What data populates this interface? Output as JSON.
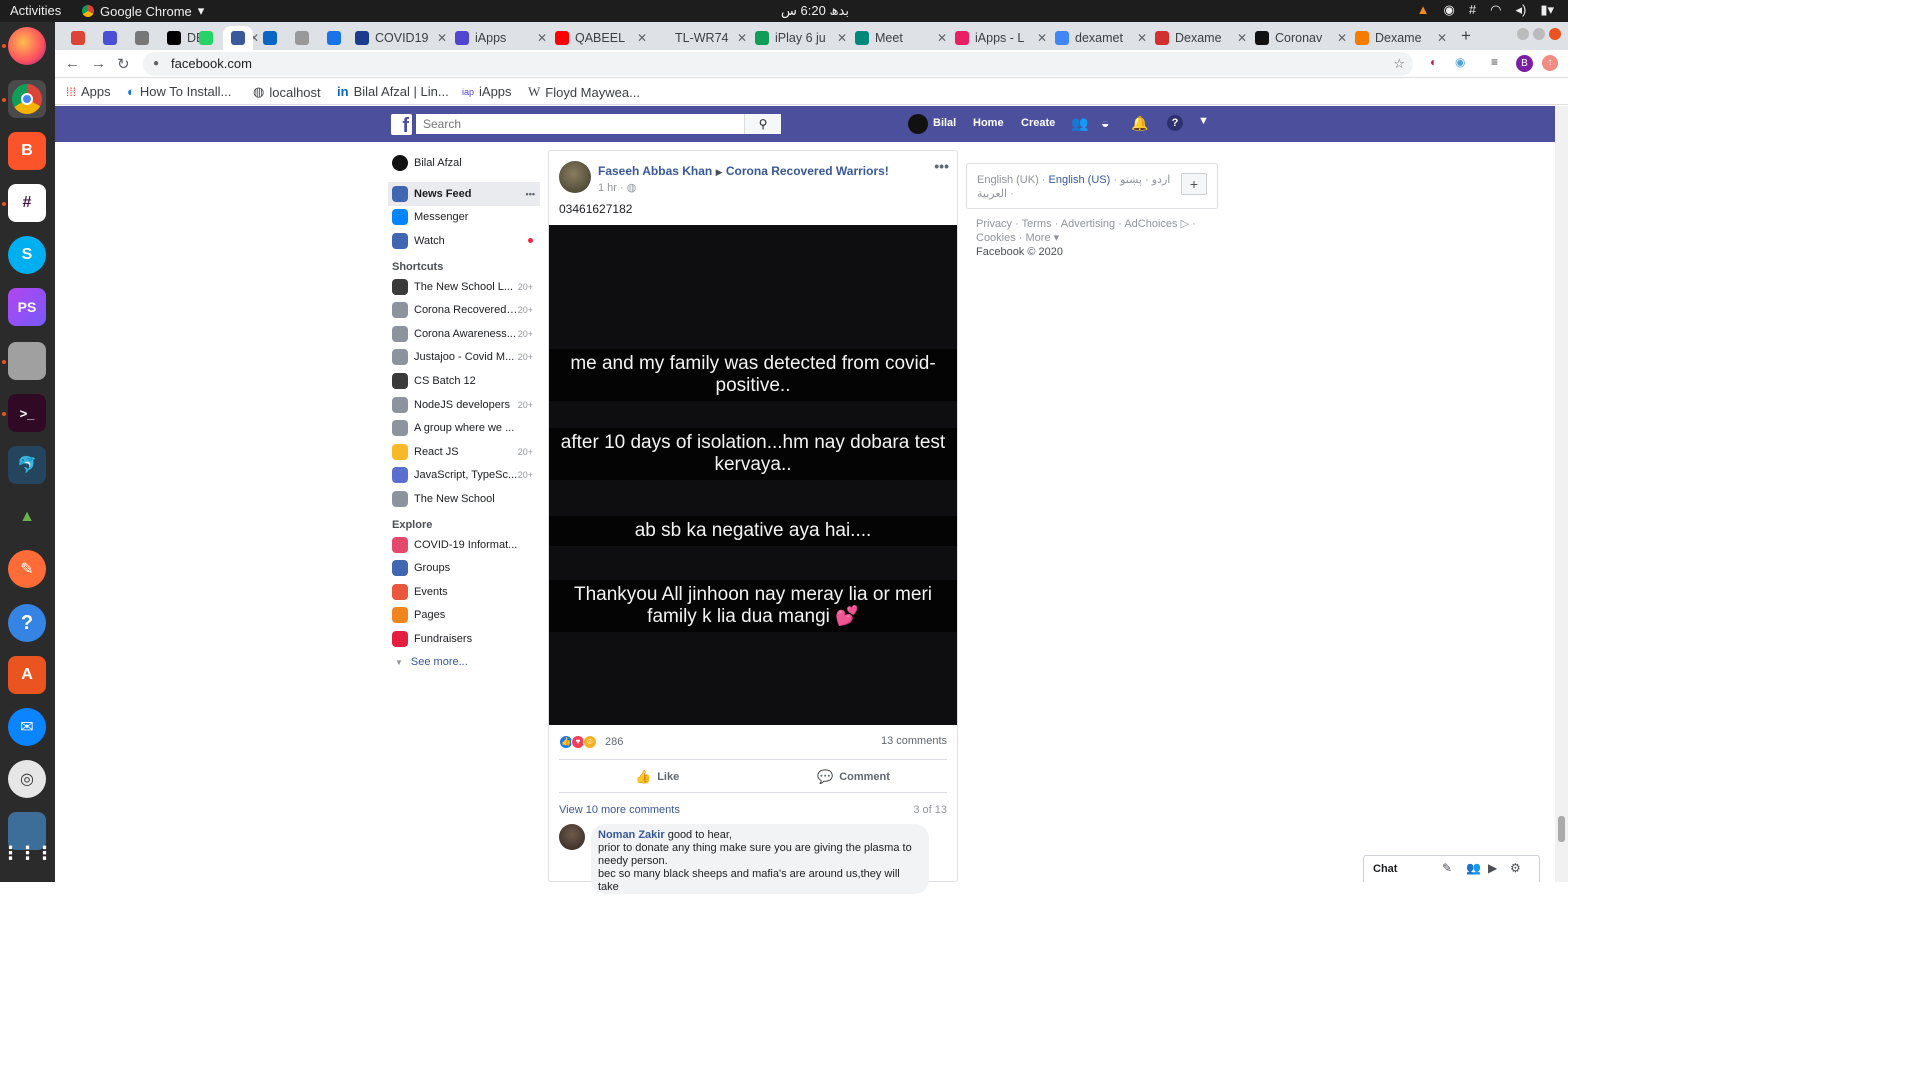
{
  "system": {
    "activities": "Activities",
    "app_name": "Google Chrome",
    "clock": "بدھ 6:20 س",
    "tray_icons": [
      "vlc-icon",
      "record-icon",
      "slack-icon",
      "wifi-icon",
      "volume-icon",
      "battery-icon"
    ]
  },
  "dock": [
    "firefox",
    "chrome",
    "brave",
    "slack",
    "skype",
    "phpstorm",
    "files",
    "terminal",
    "mysql-workbench",
    "rocket",
    "postman",
    "help",
    "software-center",
    "thunderbird",
    "rhythmbox",
    "screen",
    "show-apps"
  ],
  "browser": {
    "tabs": [
      {
        "label": "",
        "color": "#db4437"
      },
      {
        "label": "",
        "color": "#4a4fd4"
      },
      {
        "label": "",
        "color": "#777"
      },
      {
        "label": "DEV",
        "color": "#000"
      },
      {
        "label": "",
        "color": "#25d366"
      },
      {
        "label": "",
        "color": "#3b5998"
      },
      {
        "label": "",
        "color": "#0a66c2"
      },
      {
        "label": "",
        "color": "#999"
      },
      {
        "label": "",
        "color": "#1a73e8"
      },
      {
        "label": "COVID19",
        "color": "#1b3c8d"
      },
      {
        "label": "iApps",
        "color": "#5146d1"
      },
      {
        "label": "QABEEL",
        "color": "#ff0000"
      },
      {
        "label": "TL-WR74",
        "color": "#dee1e6"
      },
      {
        "label": "iPlay 6 ju",
        "color": "#0f9d58"
      },
      {
        "label": "Meet",
        "color": "#00897b"
      },
      {
        "label": "iApps - L",
        "color": "#e91e63"
      },
      {
        "label": "dexamet",
        "color": "#4285f4"
      },
      {
        "label": "Dexame",
        "color": "#d32f2f"
      },
      {
        "label": "Coronav",
        "color": "#111"
      },
      {
        "label": "Dexame",
        "color": "#f57c00"
      }
    ],
    "url": "facebook.com",
    "bookmarks": [
      "Apps",
      "How To Install...",
      "localhost",
      "Bilal Afzal | Lin...",
      "iApps",
      "Floyd Maywea..."
    ],
    "profile_initial": "B"
  },
  "fb": {
    "logo": "f",
    "search_placeholder": "Search",
    "user_short": "Bilal",
    "nav": [
      "Home",
      "Create"
    ],
    "left": {
      "user": "Bilal Afzal",
      "main": [
        {
          "label": "News Feed",
          "icon": "news-feed-icon",
          "color": "#4267b2",
          "bold": true
        },
        {
          "label": "Messenger",
          "icon": "messenger-icon",
          "color": "#0084ff"
        },
        {
          "label": "Watch",
          "icon": "watch-icon",
          "color": "#4267b2",
          "dot": true
        }
      ],
      "shortcuts_title": "Shortcuts",
      "shortcuts": [
        {
          "label": "The New School L...",
          "count": "20+",
          "color": "#3a3a3a"
        },
        {
          "label": "Corona Recovered ...",
          "count": "20+",
          "color": "#8d949e"
        },
        {
          "label": "Corona Awareness...",
          "count": "20+",
          "color": "#8d949e"
        },
        {
          "label": "Justajoo - Covid M...",
          "count": "20+",
          "color": "#8d949e"
        },
        {
          "label": "CS Batch 12",
          "count": "",
          "color": "#3a3a3a"
        },
        {
          "label": "NodeJS developers",
          "count": "20+",
          "color": "#8d949e"
        },
        {
          "label": "A group where we ...",
          "count": "",
          "color": "#8d949e"
        },
        {
          "label": "React JS",
          "count": "20+",
          "color": "#f7b928"
        },
        {
          "label": "JavaScript, TypeSc...",
          "count": "20+",
          "color": "#5b6fd1"
        },
        {
          "label": "The New School",
          "count": "",
          "color": "#8d949e"
        }
      ],
      "explore_title": "Explore",
      "explore": [
        {
          "label": "COVID-19 Informat...",
          "color": "#e4496c"
        },
        {
          "label": "Groups",
          "color": "#4267b2"
        },
        {
          "label": "Events",
          "color": "#e9573f"
        },
        {
          "label": "Pages",
          "color": "#f0841d"
        },
        {
          "label": "Fundraisers",
          "color": "#e41e3f"
        }
      ],
      "see_more": "See more..."
    },
    "post": {
      "author": "Faseeh Abbas Khan",
      "group": "Corona Recovered Warriors!",
      "time": "1 hr",
      "text": "03461627182",
      "captions": [
        "me and my family was detected from covid-positive..",
        "after 10 days of isolation...hm nay dobara test kervaya..",
        "ab sb ka negative aya hai....",
        "Thankyou All jinhoon nay meray lia or meri family k lia dua mangi 💕"
      ],
      "reactions": "286",
      "comments_count": "13 comments",
      "like": "Like",
      "comment": "Comment",
      "view_more": "View 10 more comments",
      "paging": "3 of 13",
      "first_comment": {
        "name": "Noman Zakir",
        "lines": [
          "good to hear,",
          "prior to donate any thing make sure you are giving the plasma to needy person.",
          "bec so many black sheeps and mafia's are around us,they will take"
        ]
      }
    },
    "right": {
      "languages": "English (UK) · English (US) · اردو · پښتو · العربية",
      "lang_uk": "English (UK)",
      "lang_us": "English (US)",
      "lang_other": "· اردو · پښتو · العربية",
      "footer_links": "Privacy · Terms · Advertising · AdChoices ▷ · Cookies · More ▾",
      "copyright": "Facebook © 2020"
    },
    "chat_label": "Chat"
  }
}
